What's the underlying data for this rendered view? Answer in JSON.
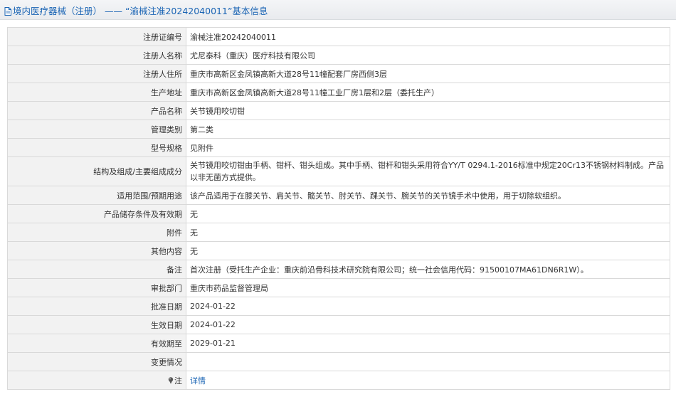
{
  "header": {
    "category": "境内医疗器械（注册）",
    "separator": "——",
    "record_title": "“渝械注准20242040011”基本信息"
  },
  "rows": [
    {
      "label": "注册证编号",
      "value": "渝械注准20242040011"
    },
    {
      "label": "注册人名称",
      "value": "尤尼泰科（重庆）医疗科技有限公司"
    },
    {
      "label": "注册人住所",
      "value": "重庆市高新区金凤镇高新大道28号11幢配套厂房西侧3层"
    },
    {
      "label": "生产地址",
      "value": "重庆市高新区金凤镇高新大道28号11幢工业厂房1层和2层（委托生产）"
    },
    {
      "label": "产品名称",
      "value": "关节镜用咬切钳"
    },
    {
      "label": "管理类别",
      "value": "第二类"
    },
    {
      "label": "型号规格",
      "value": "见附件"
    },
    {
      "label": "结构及组成/主要组成成分",
      "value": "关节镜用咬切钳由手柄、钳杆、钳头组成。其中手柄、钳杆和钳头采用符合YY/T 0294.1-2016标准中规定20Cr13不锈钢材料制成。产品以非无菌方式提供。"
    },
    {
      "label": "适用范围/预期用途",
      "value": "该产品适用于在膝关节、肩关节、髋关节、肘关节、踝关节、腕关节的关节镜手术中使用，用于切除软组织。"
    },
    {
      "label": "产品储存条件及有效期",
      "value": "无"
    },
    {
      "label": "附件",
      "value": "无"
    },
    {
      "label": "其他内容",
      "value": "无"
    },
    {
      "label": "备注",
      "value": "首次注册（受托生产企业：重庆前沿骨科技术研究院有限公司；统一社会信用代码：91500107MA61DN6R1W）。"
    },
    {
      "label": "审批部门",
      "value": "重庆市药品监督管理局"
    },
    {
      "label": "批准日期",
      "value": "2024-01-22"
    },
    {
      "label": "生效日期",
      "value": "2024-01-22"
    },
    {
      "label": "有效期至",
      "value": "2029-01-21"
    },
    {
      "label": "变更情况",
      "value": ""
    }
  ],
  "note": {
    "label": "注",
    "link_text": "详情",
    "icon": "pin-icon"
  }
}
